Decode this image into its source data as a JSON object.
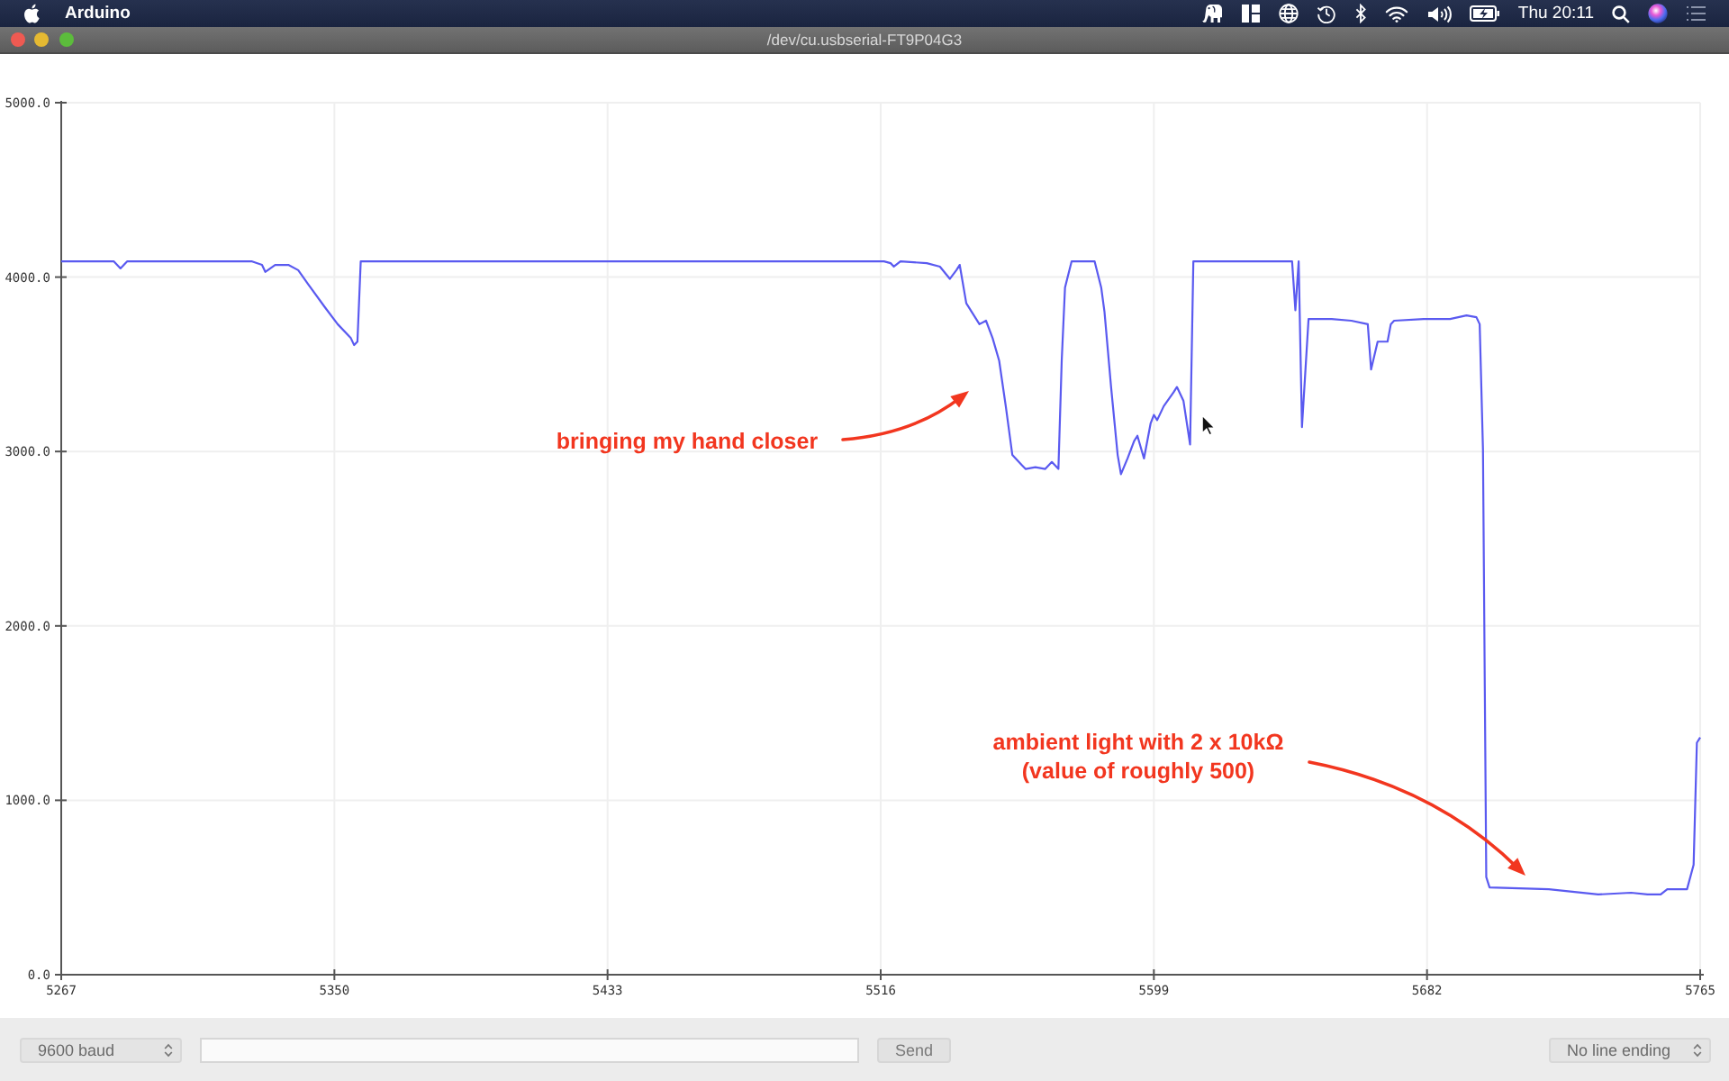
{
  "menu_bar": {
    "app_name": "Arduino",
    "clock": "Thu 20:11"
  },
  "window": {
    "title": "/dev/cu.usbserial-FT9P04G3"
  },
  "plotter": {
    "chart_data": {
      "type": "line",
      "grid": true,
      "x": [
        5267,
        5283,
        5285,
        5287,
        5325,
        5328,
        5329,
        5332,
        5336,
        5339,
        5342,
        5347,
        5351,
        5355,
        5356,
        5357,
        5358,
        5517,
        5519,
        5520,
        5522,
        5530,
        5534,
        5537,
        5539,
        5540,
        5542,
        5546,
        5548,
        5550,
        5552,
        5554,
        5556,
        5559,
        5560,
        5563,
        5566,
        5568,
        5570,
        5571,
        5572,
        5574,
        5581,
        5583,
        5584,
        5586,
        5588,
        5589,
        5591,
        5593,
        5594,
        5596,
        5598,
        5599,
        5600,
        5602,
        5605,
        5606,
        5608,
        5610,
        5611,
        5641,
        5642,
        5643,
        5644,
        5646,
        5653,
        5659,
        5664,
        5665,
        5667,
        5670,
        5671,
        5672,
        5681,
        5689,
        5694,
        5697,
        5698,
        5699,
        5700,
        5701,
        5719,
        5734,
        5744,
        5749,
        5753,
        5755,
        5761,
        5763,
        5764,
        5765
      ],
      "series": [
        {
          "color": "#5a5af0",
          "values": [
            4090,
            4090,
            4050,
            4090,
            4090,
            4070,
            4030,
            4070,
            4070,
            4040,
            3960,
            3830,
            3730,
            3650,
            3610,
            3630,
            4090,
            4090,
            4080,
            4060,
            4090,
            4080,
            4060,
            3990,
            4040,
            4070,
            3850,
            3730,
            3750,
            3650,
            3520,
            3260,
            2980,
            2920,
            2900,
            2910,
            2900,
            2940,
            2900,
            3520,
            3940,
            4090,
            4090,
            3940,
            3800,
            3370,
            2980,
            2870,
            2960,
            3060,
            3090,
            2960,
            3160,
            3210,
            3180,
            3260,
            3340,
            3370,
            3290,
            3040,
            4090,
            4090,
            3810,
            4090,
            3140,
            3760,
            3760,
            3750,
            3730,
            3470,
            3630,
            3630,
            3730,
            3750,
            3760,
            3760,
            3780,
            3770,
            3730,
            3010,
            560,
            500,
            490,
            460,
            470,
            460,
            460,
            490,
            490,
            630,
            1330,
            1360
          ]
        }
      ],
      "xlim": [
        5267,
        5765
      ],
      "ylim": [
        0,
        5000
      ],
      "xticks": [
        5267,
        5350,
        5433,
        5516,
        5599,
        5682,
        5765
      ],
      "yticks": [
        {
          "value": 0,
          "label": "0.0"
        },
        {
          "value": 1000,
          "label": "1000.0"
        },
        {
          "value": 2000,
          "label": "2000.0"
        },
        {
          "value": 3000,
          "label": "3000.0"
        },
        {
          "value": 4000,
          "label": "4000.0"
        },
        {
          "value": 5000,
          "label": "5000.0"
        }
      ],
      "annotations": [
        "bringing my hand closer",
        "ambient light with 2 x 10kΩ\n(value of roughly 500)"
      ]
    }
  },
  "toolbar": {
    "baud_rate": "9600 baud",
    "send_button": "Send",
    "line_ending": "No line ending"
  }
}
